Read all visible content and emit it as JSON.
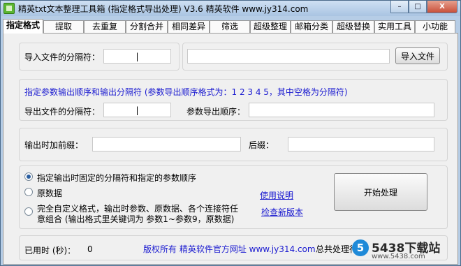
{
  "window": {
    "title": "精英txt文本整理工具箱 (指定格式导出处理) V3.6  精英软件 www.jy314.com",
    "controls": {
      "minimize": "–",
      "maximize": "□",
      "close": "X"
    }
  },
  "tabs": [
    {
      "label": "指定格式"
    },
    {
      "label": "提取"
    },
    {
      "label": "去重复"
    },
    {
      "label": "分割合并"
    },
    {
      "label": "相同差异"
    },
    {
      "label": "筛选"
    },
    {
      "label": "超级整理"
    },
    {
      "label": "邮箱分类"
    },
    {
      "label": "超级替换"
    },
    {
      "label": "实用工具"
    },
    {
      "label": "小功能"
    }
  ],
  "import": {
    "separator_label": "导入文件的分隔符：",
    "separator_value": "|",
    "path_value": "",
    "import_button": "导入文件"
  },
  "export": {
    "hint": "指定参数输出顺序和输出分隔符 (参数导出顺序格式为：1 2 3 4 5，其中空格为分隔符)",
    "separator_label": "导出文件的分隔符：",
    "separator_value": "|",
    "order_label": "参数导出顺序：",
    "order_value": ""
  },
  "affix": {
    "prefix_label": "输出时加前缀：",
    "prefix_value": "",
    "suffix_label": "后缀：",
    "suffix_value": ""
  },
  "options": {
    "opt1": "指定输出时固定的分隔符和指定的参数顺序",
    "opt2": "原数据",
    "opt3_line1": "完全自定义格式，输出时参数、原数据、各个连接符任",
    "opt3_line2": "意组合 (输出格式里关键词为 参数1~参数9，原数据)",
    "selected": "opt1",
    "help_link": "使用说明",
    "update_link": "检查新版本",
    "start_button": "开始处理"
  },
  "status": {
    "elapsed_label": "已用时 (秒)：",
    "elapsed_value": "0",
    "copyright": "版权所有 精英软件官方网址  www.jy314.com",
    "total_label": "总共处理行："
  },
  "watermark": {
    "logo": "5",
    "text": "5438下载站",
    "url": "www.5438.com"
  }
}
